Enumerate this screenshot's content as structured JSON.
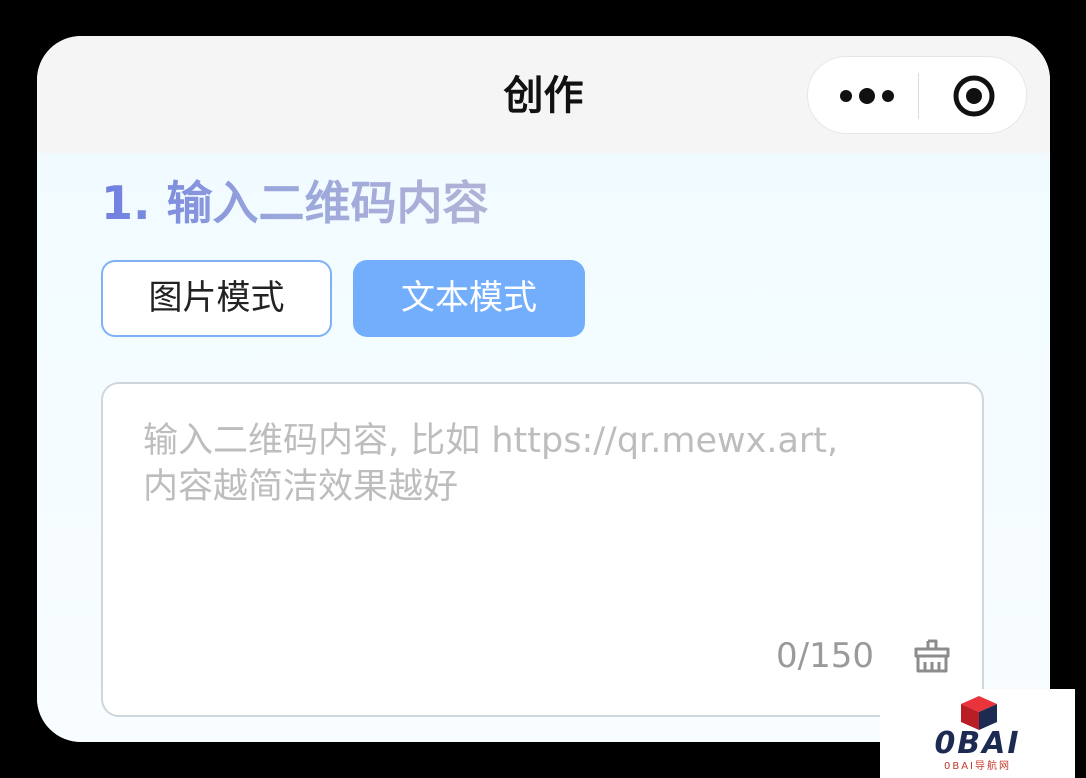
{
  "navbar": {
    "title": "创作",
    "more_icon": "more-dots-icon",
    "close_icon": "target-close-icon"
  },
  "section": {
    "title": "1. 输入二维码内容"
  },
  "modes": {
    "image_label": "图片模式",
    "text_label": "文本模式",
    "selected": "文本模式"
  },
  "input": {
    "placeholder": "输入二维码内容, 比如 https://qr.mewx.art,\n内容越简洁效果越好",
    "value": "",
    "counter": "0/150",
    "clear_icon": "broom-clear-icon"
  },
  "watermark": {
    "logo_text": "0BAI",
    "sub_text": "0BAI导航网"
  },
  "colors": {
    "accent": "#73aefc",
    "title_gradient_start": "#6f7fe0",
    "title_gradient_end": "#b2b2d6",
    "navbar_bg": "#f5f5f5",
    "content_bg": "#f1fbff"
  }
}
